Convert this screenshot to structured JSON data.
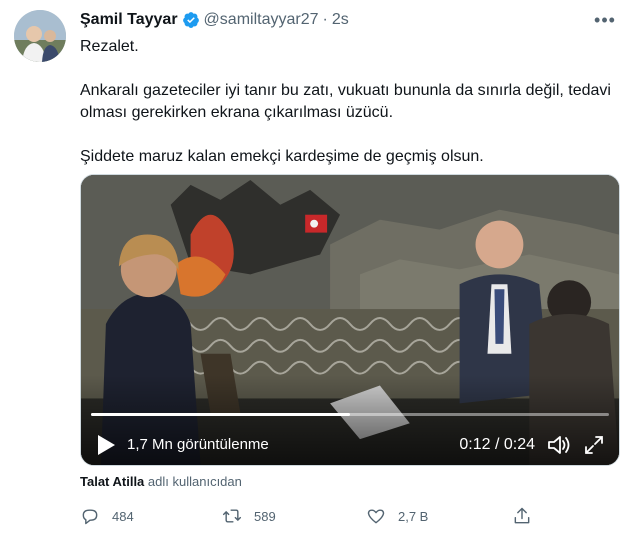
{
  "tweet": {
    "author_name": "Şamil Tayyar",
    "handle": "@samiltayyar27",
    "separator": "·",
    "time": "2s",
    "more_label": "•••",
    "paragraphs": [
      "Rezalet.",
      "Ankaralı gazeteciler iyi tanır bu zatı, vukuatı bununla da sınırla değil, tedavi olması gerekirken ekrana çıkarılması üzücü.",
      "Şiddete maruz kalan emekçi kardeşime de geçmiş olsun."
    ]
  },
  "video": {
    "views": "1,7 Mn görüntülenme",
    "duration": "0:12 / 0:24",
    "progress_fraction": 0.5
  },
  "attribution": {
    "user": "Talat Atilla",
    "suffix": "adlı kullanıcıdan"
  },
  "actions": {
    "replies": "484",
    "retweets": "589",
    "likes": "2,7 B"
  },
  "colors": {
    "verified": "#1d9bf0",
    "secondary_text": "#536471",
    "primary_text": "#0f1419"
  }
}
